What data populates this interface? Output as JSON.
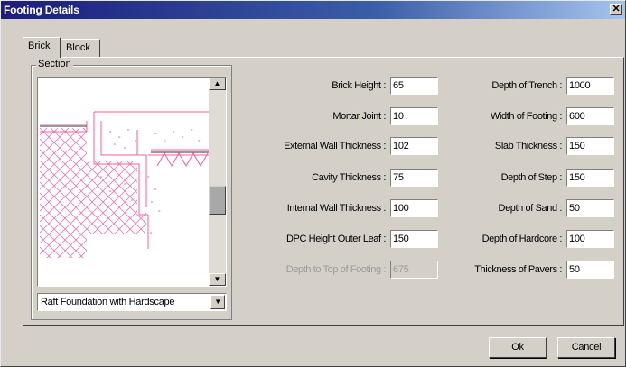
{
  "window": {
    "title": "Footing Details",
    "close_glyph": "✕"
  },
  "tabs": [
    {
      "label": "Brick",
      "active": true
    },
    {
      "label": "Block",
      "active": false
    }
  ],
  "section": {
    "group_label": "Section",
    "scroll_up_glyph": "▲",
    "scroll_down_glyph": "▼",
    "foundation_type": "Raft Foundation with Hardscape",
    "dropdown_glyph": "▼"
  },
  "left_fields": [
    {
      "label": "Brick Height :",
      "value": "65",
      "enabled": true
    },
    {
      "label": "Mortar Joint :",
      "value": "10",
      "enabled": true
    },
    {
      "label": "External Wall Thickness :",
      "value": "102",
      "enabled": true
    },
    {
      "label": "Cavity Thickness :",
      "value": "75",
      "enabled": true
    },
    {
      "label": "Internal Wall Thickness :",
      "value": "100",
      "enabled": true
    },
    {
      "label": "DPC Height Outer Leaf :",
      "value": "150",
      "enabled": true
    },
    {
      "label": "Depth to Top of Footing :",
      "value": "675",
      "enabled": false
    }
  ],
  "right_fields": [
    {
      "label": "Depth of Trench :",
      "value": "1000",
      "enabled": true
    },
    {
      "label": "Width of Footing :",
      "value": "600",
      "enabled": true
    },
    {
      "label": "Slab Thickness :",
      "value": "150",
      "enabled": true
    },
    {
      "label": "Depth of Step :",
      "value": "150",
      "enabled": true
    },
    {
      "label": "Depth of Sand :",
      "value": "50",
      "enabled": true
    },
    {
      "label": "Depth of Hardcore :",
      "value": "100",
      "enabled": true
    },
    {
      "label": "Thickness of Pavers :",
      "value": "50",
      "enabled": true
    }
  ],
  "buttons": {
    "ok": "Ok",
    "cancel": "Cancel"
  },
  "colors": {
    "title_bar_start": "#1c1c7c",
    "title_bar_end": "#a6c4ee",
    "dialog_face": "#d4d0c8",
    "section_lines": "#ff5aa8"
  }
}
